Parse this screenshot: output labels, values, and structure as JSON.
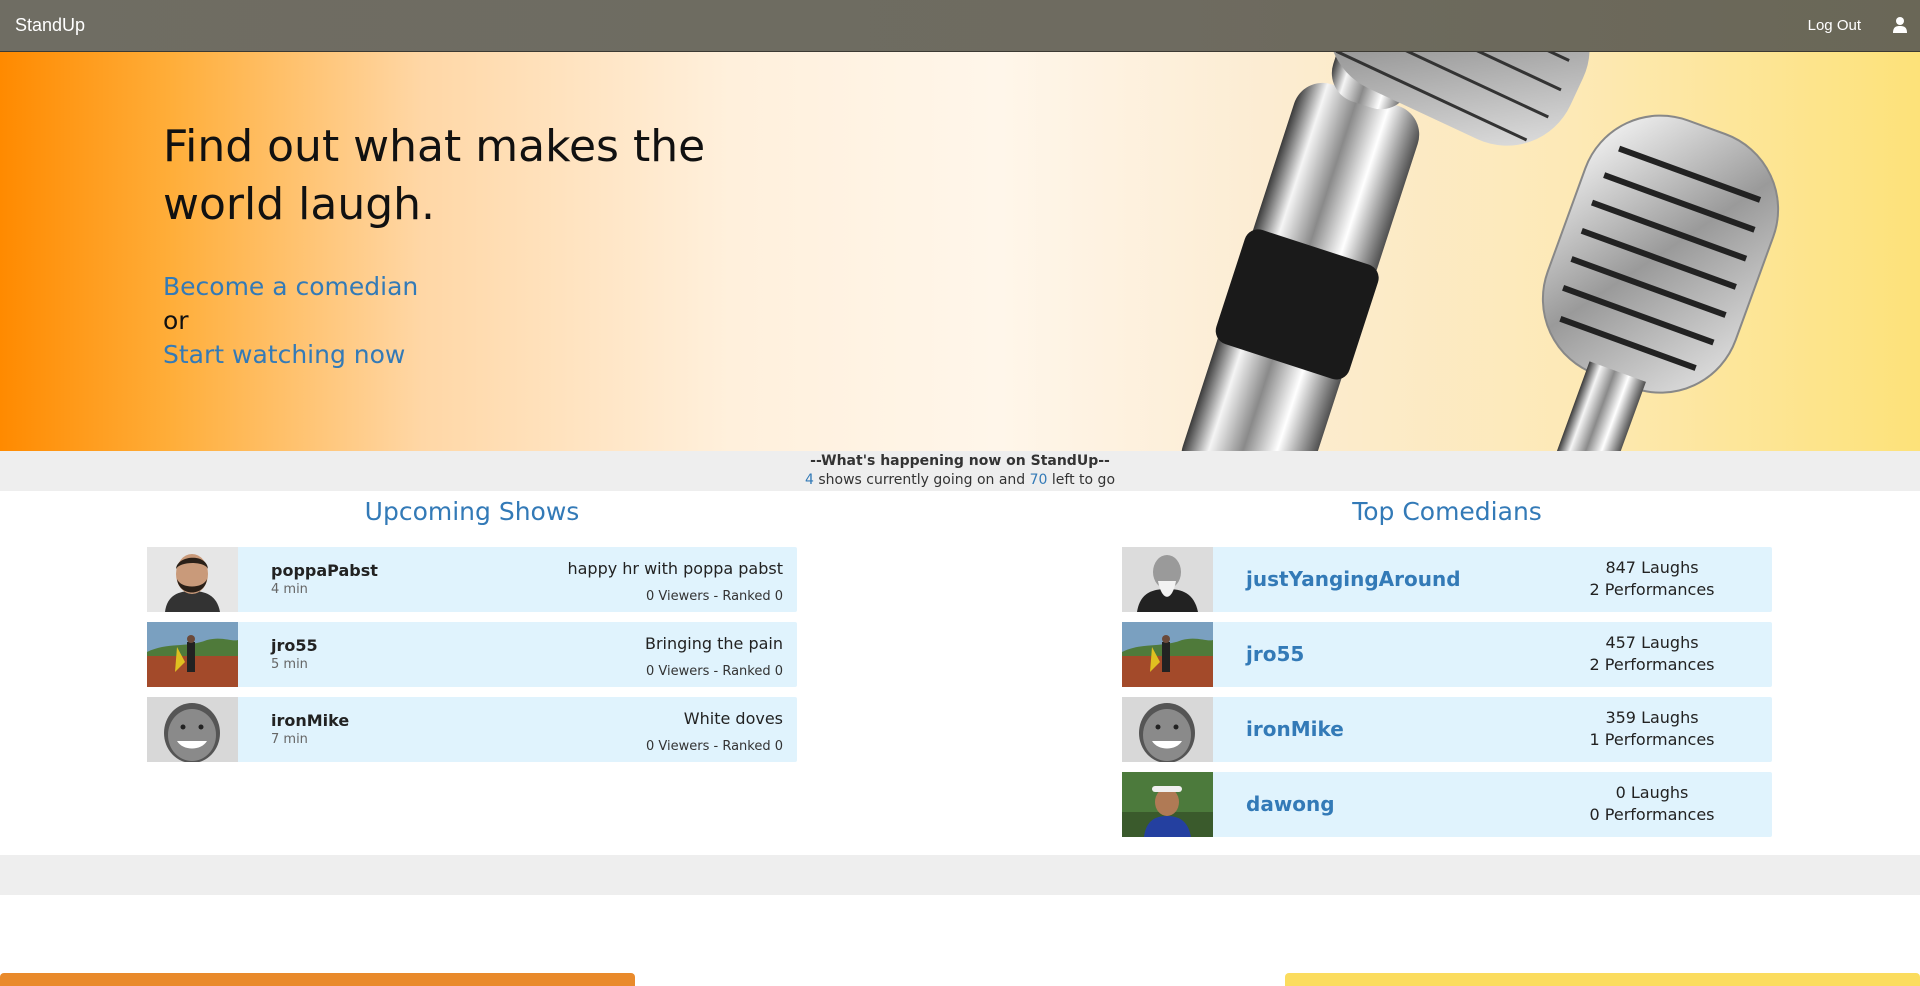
{
  "navbar": {
    "brand": "StandUp",
    "logout_label": "Log Out",
    "user_icon": "user-icon"
  },
  "hero": {
    "headline": "Find out what makes the world laugh.",
    "become_link": "Become a comedian",
    "or_text": "or",
    "watch_link": "Start watching now"
  },
  "status": {
    "title": "--What's happening now on StandUp--",
    "current_count": "4",
    "middle_text": "shows currently going on and",
    "left_count": "70",
    "end_text": "left to go"
  },
  "upcoming": {
    "title": "Upcoming Shows",
    "shows": [
      {
        "name": "poppaPabst",
        "duration": "4 min",
        "title": "happy hr with poppa pabst",
        "meta": "0 Viewers - Ranked 0"
      },
      {
        "name": "jro55",
        "duration": "5 min",
        "title": "Bringing the pain",
        "meta": "0 Viewers - Ranked 0"
      },
      {
        "name": "ironMike",
        "duration": "7 min",
        "title": "White doves",
        "meta": "0 Viewers - Ranked 0"
      }
    ]
  },
  "top": {
    "title": "Top Comedians",
    "comedians": [
      {
        "name": "justYangingAround",
        "laughs": "847 Laughs",
        "performances": "2 Performances"
      },
      {
        "name": "jro55",
        "laughs": "457 Laughs",
        "performances": "2 Performances"
      },
      {
        "name": "ironMike",
        "laughs": "359 Laughs",
        "performances": "1 Performances"
      },
      {
        "name": "dawong",
        "laughs": "0 Laughs",
        "performances": "0 Performances"
      }
    ]
  },
  "colors": {
    "accent": "#337ab7",
    "card_bg": "#e0f3fd",
    "hero_orange": "#ff8a00",
    "hero_yellow": "#fde279"
  }
}
